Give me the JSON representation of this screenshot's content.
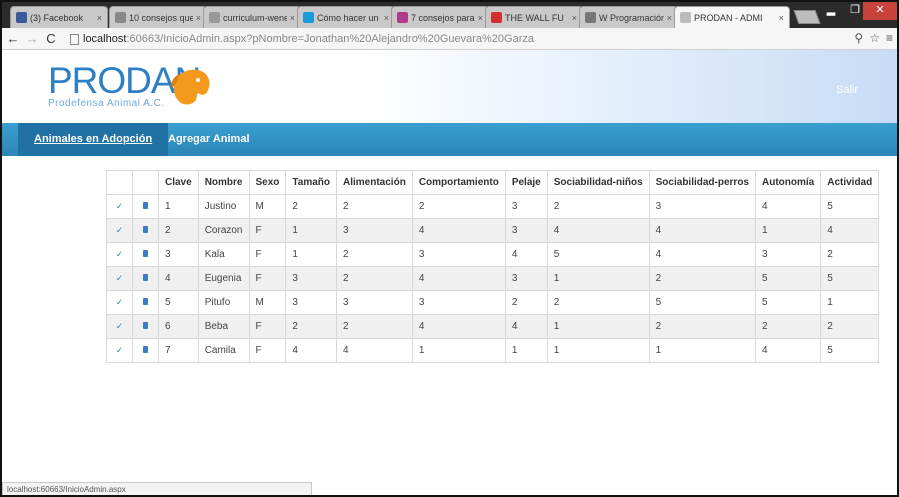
{
  "browser": {
    "tabs": [
      {
        "label": "(3) Facebook",
        "color": "#3b5998"
      },
      {
        "label": "10 consejos que",
        "color": "#888888"
      },
      {
        "label": "curriculum-wene",
        "color": "#999999"
      },
      {
        "label": "Cómo hacer un c",
        "color": "#1a9bd7"
      },
      {
        "label": "7 consejos para",
        "color": "#b03a8c"
      },
      {
        "label": "THE WALL FU",
        "color": "#d32f2f"
      },
      {
        "label": "W Programación o",
        "color": "#777777"
      },
      {
        "label": "PRODAN - ADMI",
        "color": "#bbbbbb"
      }
    ],
    "url_host": "localhost",
    "url_rest": ":60663/InicioAdmin.aspx?pNombre=Jonathan%20Alejandro%20Guevara%20Garza",
    "status_url": "localhost:60663/InicioAdmin.aspx"
  },
  "site": {
    "logo_title": "PRODAN",
    "logo_subtitle": "Prodefensa Animal A.C.",
    "logout": "Salir",
    "nav": [
      "Animales en Adopción",
      "Agregar Animal"
    ]
  },
  "table": {
    "headers": [
      "Clave",
      "Nombre",
      "Sexo",
      "Tamaño",
      "Alimentación",
      "Comportamiento",
      "Pelaje",
      "Sociabilidad-niños",
      "Sociabilidad-perros",
      "Autonomía",
      "Actividad"
    ],
    "rows": [
      [
        "1",
        "Justino",
        "M",
        "2",
        "2",
        "2",
        "3",
        "2",
        "3",
        "4",
        "5"
      ],
      [
        "2",
        "Corazon",
        "F",
        "1",
        "3",
        "4",
        "3",
        "4",
        "4",
        "1",
        "4"
      ],
      [
        "3",
        "Kala",
        "F",
        "1",
        "2",
        "3",
        "4",
        "5",
        "4",
        "3",
        "2"
      ],
      [
        "4",
        "Eugenia",
        "F",
        "3",
        "2",
        "4",
        "3",
        "1",
        "2",
        "5",
        "5"
      ],
      [
        "5",
        "Pitufo",
        "M",
        "3",
        "3",
        "3",
        "2",
        "2",
        "5",
        "5",
        "1"
      ],
      [
        "6",
        "Beba",
        "F",
        "2",
        "2",
        "4",
        "4",
        "1",
        "2",
        "2",
        "2"
      ],
      [
        "7",
        "Camila",
        "F",
        "4",
        "4",
        "1",
        "1",
        "1",
        "1",
        "4",
        "5"
      ]
    ]
  }
}
